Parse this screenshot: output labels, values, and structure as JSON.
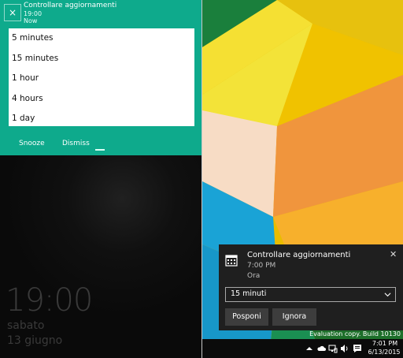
{
  "phone": {
    "toast": {
      "title": "Controllare aggiornamenti",
      "time": "19:00",
      "when": "Now",
      "close_glyph": "×",
      "snooze_options": [
        "5 minutes",
        "15 minutes",
        "1 hour",
        "4 hours",
        "1 day"
      ],
      "snooze_label": "Snooze",
      "dismiss_label": "Dismiss",
      "accent_color": "#0eaa8c"
    },
    "lockscreen": {
      "time": "19:00",
      "day": "sabato",
      "date": "13 giugno"
    }
  },
  "desktop": {
    "notification": {
      "title": "Controllare aggiornamenti",
      "time": "7:00 PM",
      "when": "Ora",
      "close_glyph": "✕",
      "select_value": "15 minuti",
      "snooze_label": "Posponi",
      "dismiss_label": "Ignora",
      "icon": "calendar-icon"
    },
    "watermark": "Evaluation copy. Build 10130",
    "taskbar": {
      "time": "7:01 PM",
      "date": "6/13/2015",
      "tray_icons": [
        "chevron-up-icon",
        "cloud-icon",
        "network-icon",
        "volume-icon",
        "action-center-icon"
      ]
    }
  }
}
